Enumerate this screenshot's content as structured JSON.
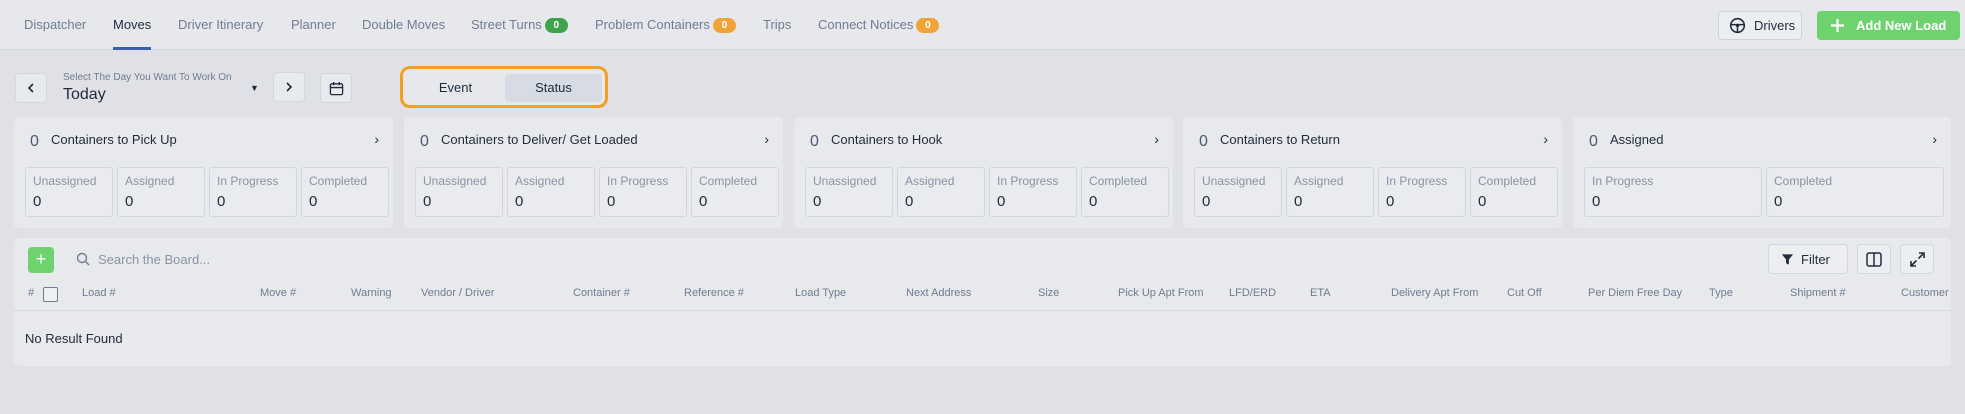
{
  "nav": {
    "tabs": [
      {
        "label": "Dispatcher"
      },
      {
        "label": "Moves"
      },
      {
        "label": "Driver Itinerary"
      },
      {
        "label": "Planner"
      },
      {
        "label": "Double Moves"
      },
      {
        "label": "Street Turns",
        "badge": "0"
      },
      {
        "label": "Problem Containers",
        "badge": "0"
      },
      {
        "label": "Trips"
      },
      {
        "label": "Connect Notices",
        "badge": "0"
      }
    ],
    "active_tab": "Moves",
    "drivers_label": "Drivers",
    "add_load_label": "Add New Load"
  },
  "day_selector": {
    "label": "Select The Day You Want To Work On",
    "value": "Today"
  },
  "view_toggle": {
    "options": [
      "Event",
      "Status"
    ],
    "selected": "Status"
  },
  "cards": [
    {
      "count": "0",
      "title": "Containers to Pick Up",
      "stats": [
        {
          "label": "Unassigned",
          "value": "0"
        },
        {
          "label": "Assigned",
          "value": "0"
        },
        {
          "label": "In Progress",
          "value": "0"
        },
        {
          "label": "Completed",
          "value": "0"
        }
      ]
    },
    {
      "count": "0",
      "title": "Containers to Deliver/ Get Loaded",
      "stats": [
        {
          "label": "Unassigned",
          "value": "0"
        },
        {
          "label": "Assigned",
          "value": "0"
        },
        {
          "label": "In Progress",
          "value": "0"
        },
        {
          "label": "Completed",
          "value": "0"
        }
      ]
    },
    {
      "count": "0",
      "title": "Containers to Hook",
      "stats": [
        {
          "label": "Unassigned",
          "value": "0"
        },
        {
          "label": "Assigned",
          "value": "0"
        },
        {
          "label": "In Progress",
          "value": "0"
        },
        {
          "label": "Completed",
          "value": "0"
        }
      ]
    },
    {
      "count": "0",
      "title": "Containers to Return",
      "stats": [
        {
          "label": "Unassigned",
          "value": "0"
        },
        {
          "label": "Assigned",
          "value": "0"
        },
        {
          "label": "In Progress",
          "value": "0"
        },
        {
          "label": "Completed",
          "value": "0"
        }
      ]
    },
    {
      "count": "0",
      "title": "Assigned",
      "stats": [
        {
          "label": "In Progress",
          "value": "0"
        },
        {
          "label": "Completed",
          "value": "0"
        }
      ]
    }
  ],
  "board": {
    "search_placeholder": "Search the Board...",
    "filter_label": "Filter",
    "columns": [
      "#",
      "Load #",
      "Move #",
      "Warning",
      "Vendor / Driver",
      "Container #",
      "Reference #",
      "Load Type",
      "Next Address",
      "Size",
      "Pick Up Apt From",
      "LFD/ERD",
      "ETA",
      "Delivery Apt From",
      "Cut Off",
      "Per Diem Free Day",
      "Type",
      "Shipment #",
      "Customer"
    ],
    "empty_message": "No Result Found"
  },
  "colors": {
    "accent_orange": "#f2a023",
    "success_green": "#6ed36e",
    "badge_green": "#3fa34d",
    "badge_orange": "#f1a33a",
    "active_underline": "#3a5fb0"
  }
}
